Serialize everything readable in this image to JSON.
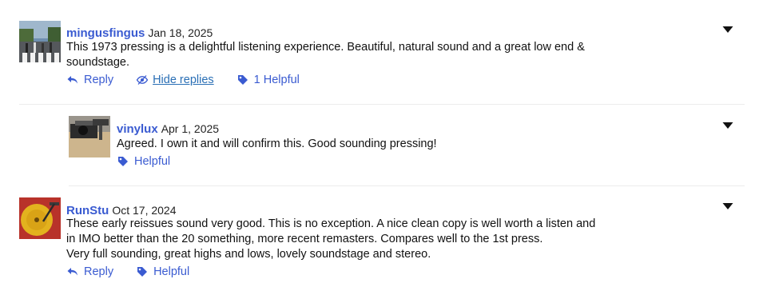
{
  "comments": [
    {
      "username": "mingusfingus",
      "date": "Jan 18, 2025",
      "lines": [
        "This 1973 pressing is a delightful listening experience. Beautiful, natural sound and a great low end &",
        "soundstage."
      ],
      "reply_label": "Reply",
      "hide_replies_label": "Hide replies",
      "helpful_label": "1 Helpful"
    },
    {
      "username": "vinylux",
      "date": "Apr 1, 2025",
      "lines": [
        "Agreed. I own it and will confirm this. Good sounding pressing!"
      ],
      "helpful_label": "Helpful"
    },
    {
      "username": "RunStu",
      "date": "Oct 17, 2024",
      "lines": [
        "These early reissues sound very good. This is no exception. A nice clean copy is well worth a listen and",
        "in IMO better than the 20 something, more recent remasters. Compares well to the 1st press.",
        "Very full sounding, great highs and lows, lovely soundstage and stereo."
      ],
      "reply_label": "Reply",
      "helpful_label": "Helpful"
    }
  ],
  "colors": {
    "link": "#3a5bd1",
    "text": "#111111",
    "divider": "#ececec"
  },
  "icons": {
    "reply": "reply-arrow-icon",
    "hide": "eye-slash-icon",
    "helpful": "tag-icon",
    "menu": "caret-down-icon"
  }
}
